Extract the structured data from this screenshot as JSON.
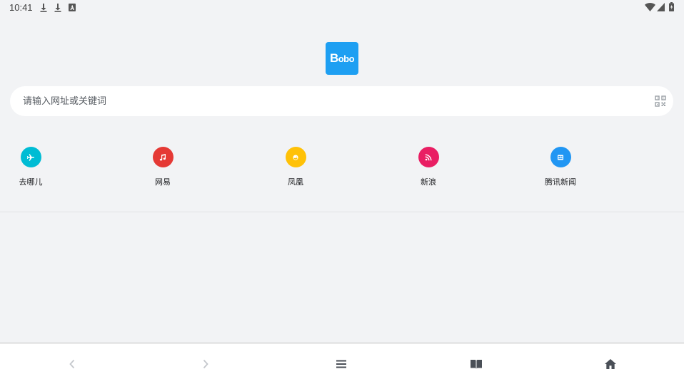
{
  "status_bar": {
    "time": "10:41",
    "icons_left": [
      "download-icon",
      "download-icon",
      "text-a-icon"
    ],
    "icons_right": [
      "wifi-icon",
      "signal-icon",
      "battery-icon"
    ]
  },
  "logo": {
    "text_big": "B",
    "text_small": "obo"
  },
  "search": {
    "placeholder": "请输入网址或关键词",
    "value": "",
    "qr_icon": "qr-code-icon"
  },
  "shortcuts": [
    {
      "label": "去哪儿",
      "color": "#00bcd4",
      "icon": "airplane-icon"
    },
    {
      "label": "网易",
      "color": "#e53935",
      "icon": "music-note-icon"
    },
    {
      "label": "凤凰",
      "color": "#ffc107",
      "icon": "bird-icon"
    },
    {
      "label": "新浪",
      "color": "#e91e63",
      "icon": "rss-icon"
    },
    {
      "label": "腾讯新闻",
      "color": "#2196f3",
      "icon": "newspaper-icon"
    }
  ],
  "bottom_nav": [
    {
      "name": "back",
      "icon": "chevron-left-icon",
      "enabled": false
    },
    {
      "name": "forward",
      "icon": "chevron-right-icon",
      "enabled": false
    },
    {
      "name": "menu",
      "icon": "menu-icon",
      "enabled": true
    },
    {
      "name": "bookmarks",
      "icon": "book-icon",
      "enabled": true
    },
    {
      "name": "home",
      "icon": "home-icon",
      "enabled": true
    }
  ],
  "colors": {
    "background": "#f2f3f5",
    "accent": "#1e9ff2",
    "icon_active": "#4a4f57",
    "icon_disabled": "#c4c7cc"
  }
}
